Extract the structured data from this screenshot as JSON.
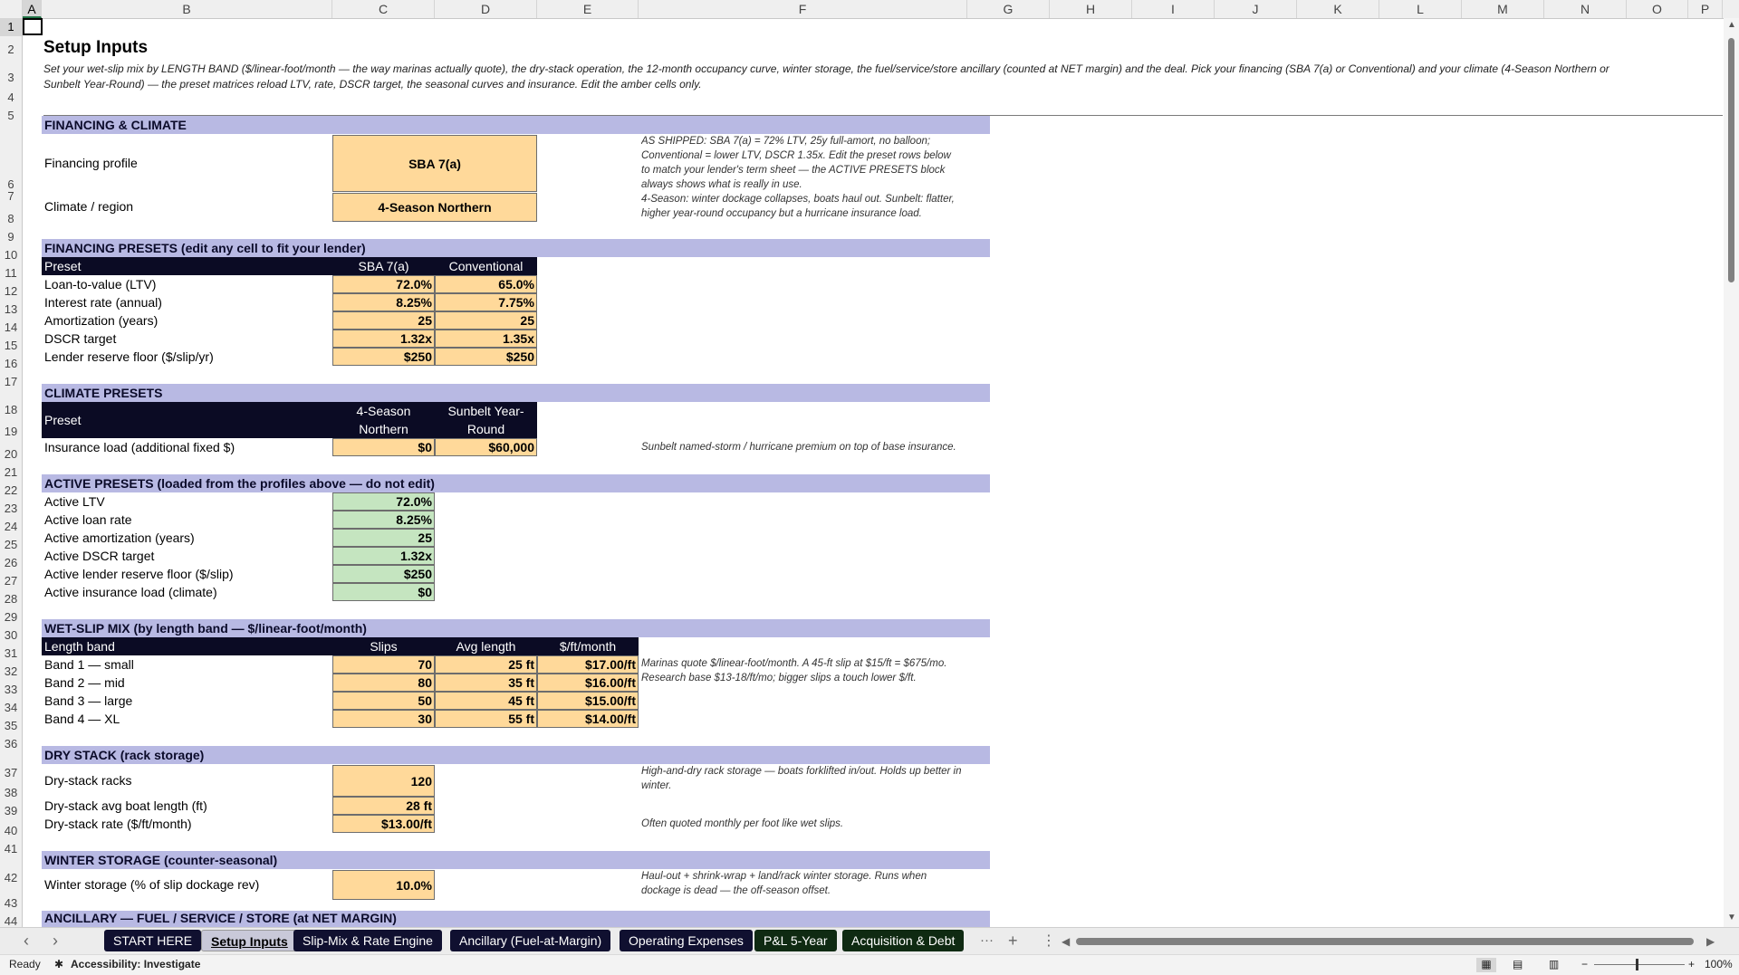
{
  "columns": [
    "A",
    "B",
    "C",
    "D",
    "E",
    "F",
    "G",
    "H",
    "I",
    "J",
    "K",
    "L",
    "M",
    "N",
    "O",
    "P"
  ],
  "rows": [
    "1",
    "2",
    "3",
    "4",
    "5",
    "6",
    "7",
    "8",
    "9",
    "10",
    "11",
    "12",
    "13",
    "14",
    "15",
    "16",
    "17",
    "18",
    "19",
    "20",
    "21",
    "22",
    "23",
    "24",
    "25",
    "26",
    "27",
    "28",
    "29",
    "30",
    "31",
    "32",
    "33",
    "34",
    "35",
    "36",
    "37",
    "38",
    "39",
    "40",
    "41",
    "42",
    "43",
    "44"
  ],
  "title": "Setup Inputs",
  "subtitle": "Set your wet-slip mix by LENGTH BAND ($/linear-foot/month — the way marinas actually quote), the dry-stack operation, the 12-month occupancy curve, winter storage, the fuel/service/store ancillary (counted at NET margin) and the deal. Pick your financing (SBA 7(a) or Conventional) and your climate (4-Season Northern or Sunbelt Year-Round) — the preset matrices reload LTV, rate, DSCR target, the seasonal curves and insurance. Edit the amber cells only.",
  "financing_climate": {
    "band": "FINANCING & CLIMATE",
    "financing_label": "Financing profile",
    "financing_value": "SBA 7(a)",
    "climate_label": "Climate / region",
    "climate_value": "4-Season Northern",
    "note_financing": "AS SHIPPED: SBA 7(a) = 72% LTV, 25y full-amort, no balloon; Conventional = lower LTV, DSCR 1.35x. Edit the preset rows below to match your lender's term sheet — the ACTIVE PRESETS block always shows what is really in use.",
    "note_climate": "4-Season: winter dockage collapses, boats haul out. Sunbelt: flatter, higher year-round occupancy but a hurricane insurance load."
  },
  "financing_presets": {
    "band": "FINANCING PRESETS  (edit any cell to fit your lender)",
    "headers": [
      "Preset",
      "SBA 7(a)",
      "Conventional"
    ],
    "rows": [
      [
        "Loan-to-value (LTV)",
        "72.0%",
        "65.0%"
      ],
      [
        "Interest rate (annual)",
        "8.25%",
        "7.75%"
      ],
      [
        "Amortization (years)",
        "25",
        "25"
      ],
      [
        "DSCR target",
        "1.32x",
        "1.35x"
      ],
      [
        "Lender reserve floor ($/slip/yr)",
        "$250",
        "$250"
      ]
    ]
  },
  "climate_presets": {
    "band": "CLIMATE PRESETS",
    "headers": [
      "Preset",
      "4-Season Northern",
      "Sunbelt Year-Round"
    ],
    "row": [
      "Insurance load (additional fixed $)",
      "$0",
      "$60,000"
    ],
    "note": "Sunbelt named-storm / hurricane premium on top of base insurance."
  },
  "active_presets": {
    "band": "ACTIVE PRESETS  (loaded from the profiles above — do not edit)",
    "rows": [
      [
        "Active LTV",
        "72.0%"
      ],
      [
        "Active loan rate",
        "8.25%"
      ],
      [
        "Active amortization (years)",
        "25"
      ],
      [
        "Active DSCR target",
        "1.32x"
      ],
      [
        "Active lender reserve floor ($/slip)",
        "$250"
      ],
      [
        "Active insurance load (climate)",
        "$0"
      ]
    ]
  },
  "wet_slip": {
    "band": "WET-SLIP MIX  (by length band — $/linear-foot/month)",
    "headers": [
      "Length band",
      "Slips",
      "Avg length",
      "$/ft/month"
    ],
    "rows": [
      [
        "Band 1 — small",
        "70",
        "25 ft",
        "$17.00/ft"
      ],
      [
        "Band 2 — mid",
        "80",
        "35 ft",
        "$16.00/ft"
      ],
      [
        "Band 3 — large",
        "50",
        "45 ft",
        "$15.00/ft"
      ],
      [
        "Band 4 — XL",
        "30",
        "55 ft",
        "$14.00/ft"
      ]
    ],
    "note": "Marinas quote $/linear-foot/month. A 45-ft slip at $15/ft = $675/mo. Research base $13-18/ft/mo; bigger slips a touch lower $/ft."
  },
  "dry_stack": {
    "band": "DRY STACK  (rack storage)",
    "rows": [
      [
        "Dry-stack racks",
        "120"
      ],
      [
        "Dry-stack avg boat length (ft)",
        "28 ft"
      ],
      [
        "Dry-stack rate ($/ft/month)",
        "$13.00/ft"
      ]
    ],
    "note1": "High-and-dry rack storage — boats forklifted in/out. Holds up better in winter.",
    "note2": "Often quoted monthly per foot like wet slips."
  },
  "winter": {
    "band": "WINTER STORAGE  (counter-seasonal)",
    "label": "Winter storage (% of slip dockage rev)",
    "value": "10.0%",
    "note": "Haul-out + shrink-wrap + land/rack winter storage. Runs when dockage is dead — the off-season offset."
  },
  "ancillary_band": "ANCILLARY — FUEL / SERVICE / STORE (at NET MARGIN)",
  "tabs": [
    "START HERE",
    "Setup Inputs",
    "Slip-Mix & Rate Engine",
    "Ancillary (Fuel-at-Margin)",
    "Operating Expenses",
    "P&L 5-Year",
    "Acquisition & Debt"
  ],
  "tab_more": "···",
  "tab_add": "+",
  "tab_menu": "⋮",
  "status": {
    "ready": "Ready",
    "accessibility": "Accessibility: Investigate",
    "zoom": "100%"
  },
  "colors": {
    "band": "#b8b9e3",
    "header": "#0b0b24",
    "amber": "#ffd99a",
    "green": "#c5e5c0"
  }
}
